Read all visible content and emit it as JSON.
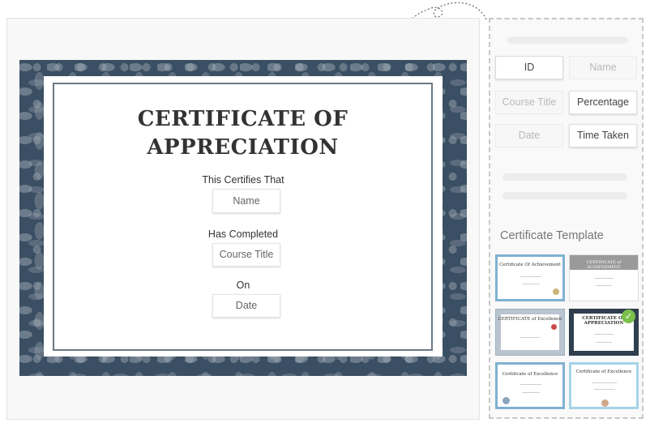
{
  "certificate": {
    "title_line1": "CERTIFICATE OF",
    "title_line2": "APPRECIATION",
    "certifies_label": "This Certifies That",
    "name_field": "Name",
    "completed_label": "Has Completed",
    "course_field": "Course Title",
    "on_label": "On",
    "date_field": "Date"
  },
  "panel": {
    "chips": [
      {
        "label": "ID",
        "active": true
      },
      {
        "label": "Name",
        "active": false
      },
      {
        "label": "Course Title",
        "active": false
      },
      {
        "label": "Percentage",
        "active": true
      },
      {
        "label": "Date",
        "active": false
      },
      {
        "label": "Time Taken",
        "active": true
      }
    ],
    "template_heading": "Certificate Template",
    "templates": [
      {
        "title": "Certificate Of Achievement",
        "selected": false
      },
      {
        "title": "CERTIFICATE of ACHIEVEMENT",
        "selected": false
      },
      {
        "title": "CERTIFICATE of Excellence",
        "selected": false
      },
      {
        "title": "CERTIFICATE OF APPRECIATION",
        "selected": true
      },
      {
        "title": "Certificate of Excellence",
        "selected": false
      },
      {
        "title": "Certificate of Excellence",
        "selected": false
      }
    ]
  },
  "colors": {
    "cert_border": "#3a4f63",
    "selected_check": "#7cc04b"
  }
}
